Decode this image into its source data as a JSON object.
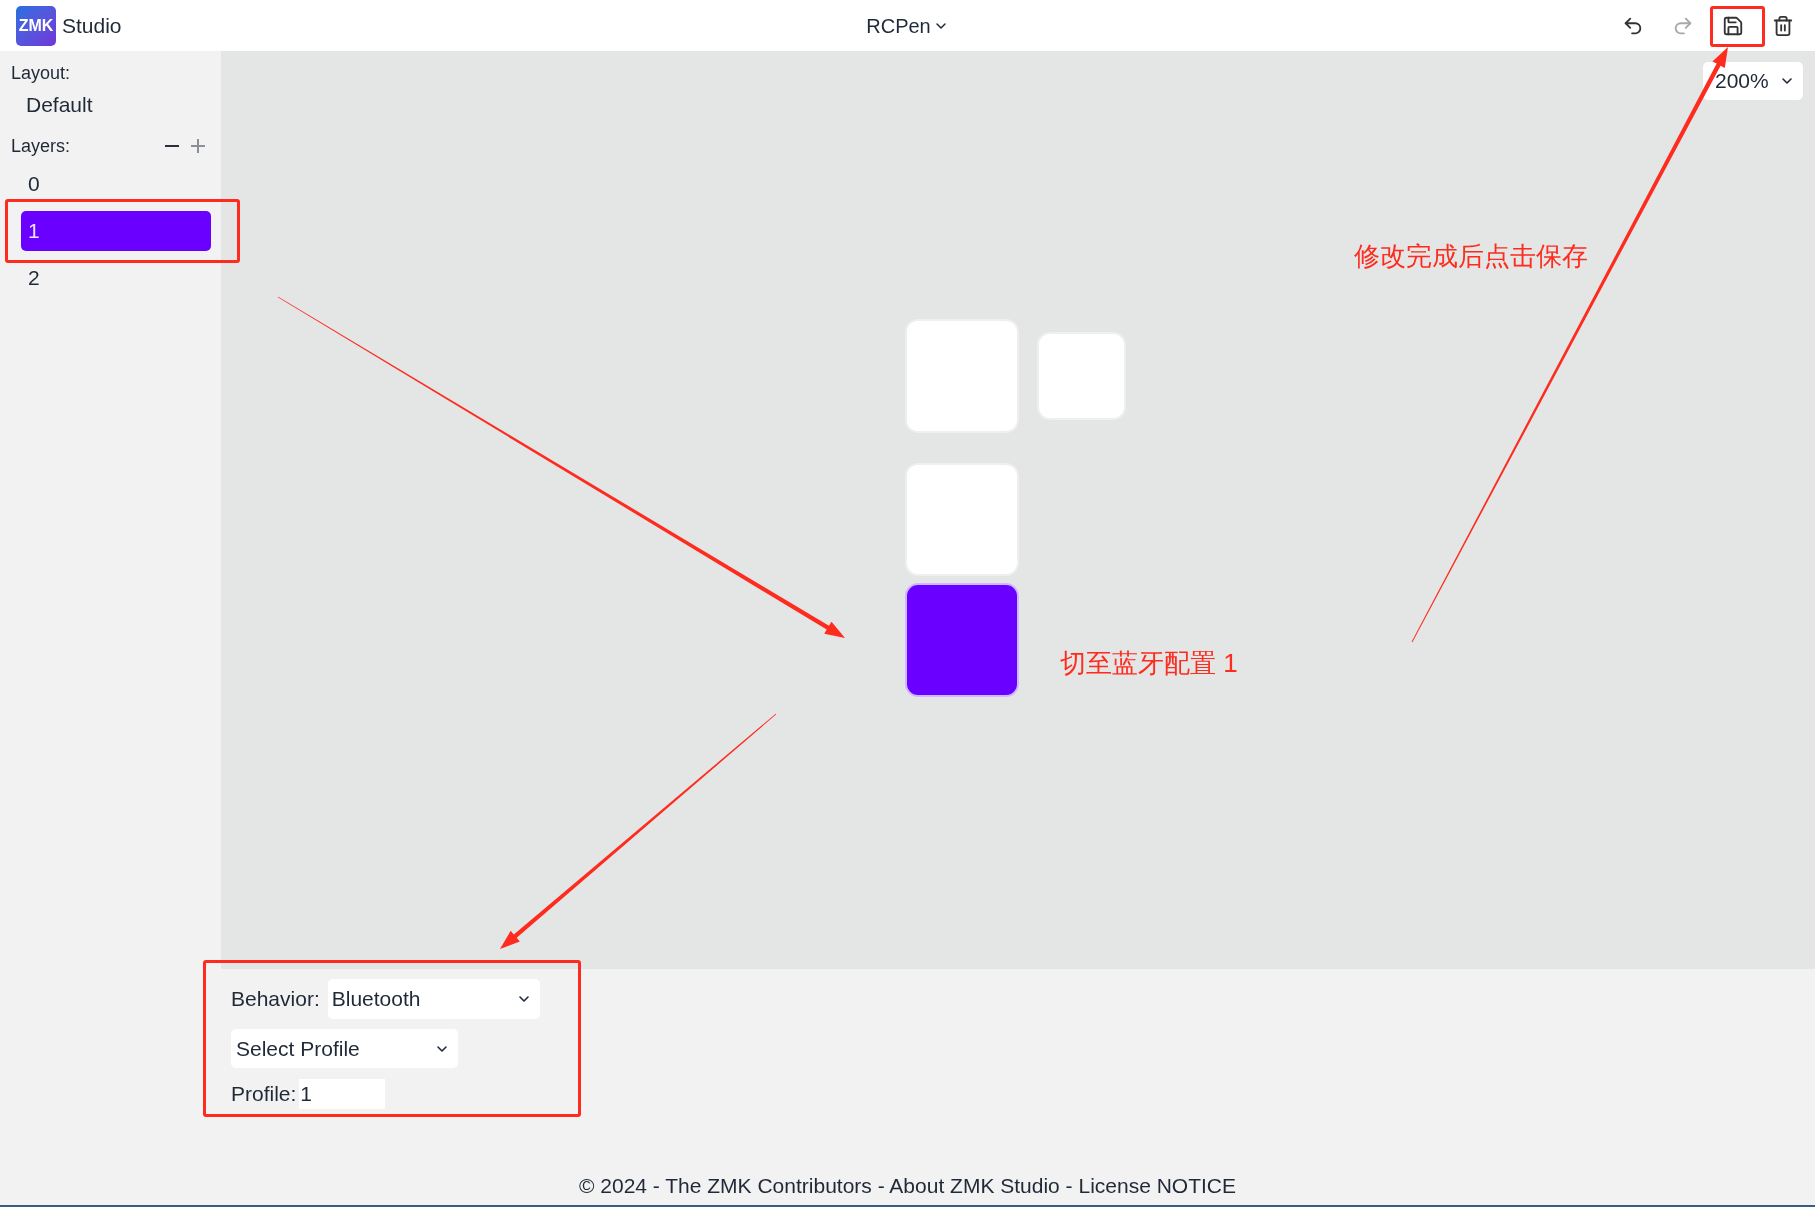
{
  "header": {
    "logo": "ZMK",
    "app_name": "Studio",
    "device": "RCPen",
    "toolbar": [
      {
        "kind": "undo",
        "disabled": false
      },
      {
        "kind": "redo",
        "disabled": true
      },
      {
        "kind": "save",
        "disabled": false
      },
      {
        "kind": "delete",
        "disabled": false
      }
    ]
  },
  "sidebar": {
    "layout_label": "Layout:",
    "layout_value": "Default",
    "layers_label": "Layers:",
    "layer_actions": [
      {
        "kind": "remove",
        "disabled": false
      },
      {
        "kind": "add",
        "disabled": true
      }
    ],
    "layers": [
      {
        "label": "0",
        "selected": false
      },
      {
        "label": "1",
        "selected": true
      },
      {
        "label": "2",
        "selected": false
      }
    ]
  },
  "canvas": {
    "zoom": "200%",
    "keys": [
      {
        "selected": false
      },
      {
        "selected": false
      },
      {
        "selected": false
      },
      {
        "selected": true
      }
    ]
  },
  "behavior_panel": {
    "behavior_label": "Behavior:",
    "behavior": "Bluetooth",
    "command": "Select Profile",
    "parameter_label": "Profile:",
    "parameter_value": "1"
  },
  "footer": {
    "prefix": "© 2024 - The ZMK Contributors - ",
    "links": [
      "About ZMK Studio",
      "License NOTICE"
    ],
    "separator": " - "
  },
  "annotations": [
    {
      "text": "修改完成后点击保存"
    },
    {
      "text": "切至蓝牙配置 1"
    }
  ]
}
